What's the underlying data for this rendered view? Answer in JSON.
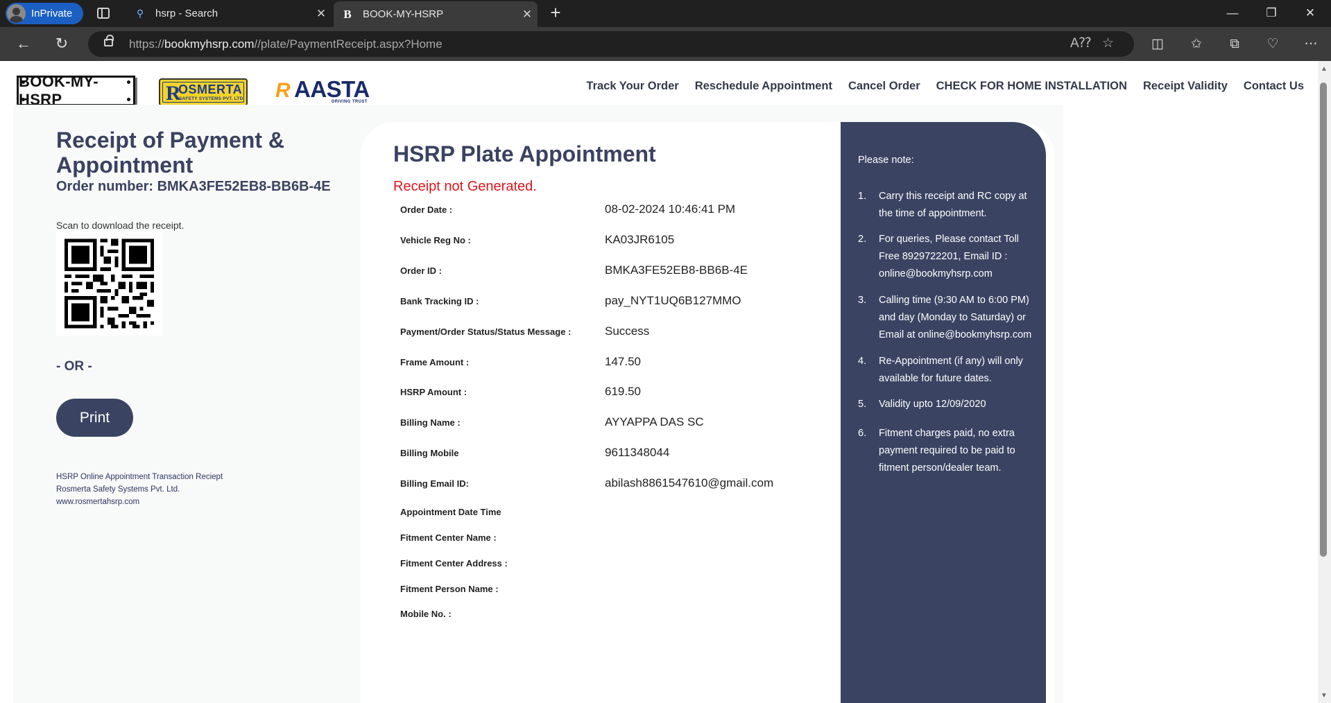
{
  "browser": {
    "inprivate_label": "InPrivate",
    "tabs": [
      {
        "label": "hsrp - Search",
        "favicon": "search-icon"
      },
      {
        "label": "BOOK-MY-HSRP",
        "favicon": "B"
      }
    ],
    "url_prefix": "https://",
    "url_host": "bookmyhsrp.com",
    "url_path": "//plate/PaymentReceipt.aspx?Home"
  },
  "site": {
    "logos": {
      "bookmyhsrp": "BOOK-MY-HSRP",
      "rosmerta_main": "OSMERTA",
      "rosmerta_r": "R",
      "rosmerta_sub": "SAFETY SYSTEMS PVT. LTD.",
      "raasta_word": "AASTA",
      "raasta_tag": "DRIVING TRUST"
    },
    "nav": [
      "Track Your Order",
      "Reschedule Appointment",
      "Cancel Order",
      "CHECK FOR HOME INSTALLATION",
      "Receipt Validity",
      "Contact Us"
    ]
  },
  "left": {
    "title": "Receipt of Payment & Appointment",
    "order_number": "Order number: BMKA3FE52EB8-BB6B-4E",
    "scan_text": "Scan to download the receipt.",
    "or_text": "- OR -",
    "print_label": "Print",
    "footer": [
      "HSRP Online Appointment Transaction Reciept",
      "Rosmerta Safety Systems Pvt. Ltd.",
      "www.rosmertahsrp.com"
    ]
  },
  "card": {
    "title": "HSRP Plate Appointment",
    "error": "Receipt not Generated.",
    "rows": [
      {
        "label": "Order Date :",
        "value": "08-02-2024 10:46:41 PM"
      },
      {
        "label": "Vehicle Reg No :",
        "value": "KA03JR6105"
      },
      {
        "label": "Order ID :",
        "value": "BMKA3FE52EB8-BB6B-4E"
      },
      {
        "label": "Bank Tracking ID :",
        "value": "pay_NYT1UQ6B127MMO"
      },
      {
        "label": "Payment/Order Status/Status Message :",
        "value": "Success"
      },
      {
        "label": "Frame Amount :",
        "value": "147.50"
      },
      {
        "label": "HSRP Amount :",
        "value": "619.50"
      },
      {
        "label": "Billing Name :",
        "value": "AYYAPPA DAS SC"
      },
      {
        "label": "Billing Mobile",
        "value": "9611348044"
      },
      {
        "label": "Billing Email ID:",
        "value": "abilash8861547610@gmail.com"
      },
      {
        "label": "Appointment Date Time",
        "value": ""
      },
      {
        "label": "Fitment Center Name :",
        "value": ""
      },
      {
        "label": "Fitment Center Address :",
        "value": ""
      },
      {
        "label": "Fitment Person Name :",
        "value": ""
      },
      {
        "label": "Mobile No. :",
        "value": ""
      }
    ]
  },
  "notes": {
    "heading": "Please note:",
    "items": [
      {
        "num": "1.",
        "text": "Carry this receipt and RC copy at the time of appointment."
      },
      {
        "num": "2.",
        "text": "For queries, Please contact Toll Free 8929722201, Email ID : online@bookmyhsrp.com"
      },
      {
        "num": "3.",
        "text": "Calling time (9:30 AM to 6:00 PM) and day (Monday to Saturday) or Email at online@bookmyhsrp.com"
      },
      {
        "num": "4.",
        "text": "Re-Appointment (if any) will only available for future dates."
      },
      {
        "num": "5.",
        "text": "Validity upto 12/09/2020"
      },
      {
        "num": "6.",
        "text": "Fitment charges paid, no extra payment required to be paid to fitment person/dealer team."
      }
    ]
  },
  "colors": {
    "navy": "#3a4462",
    "error_red": "#e0161b",
    "page_bg": "#f8f9f9"
  }
}
